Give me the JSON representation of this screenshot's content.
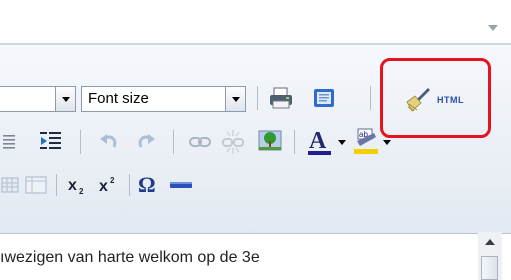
{
  "toolbar": {
    "font_size_label": "Font size",
    "html_button_label": "HTML",
    "icons": [
      "format-dropdown-arrow-icon",
      "print-icon",
      "preview-icon",
      "clean-html-brush-icon",
      "indent-icon",
      "undo-icon",
      "redo-icon",
      "link-icon",
      "unlink-icon",
      "image-icon",
      "text-color-icon",
      "background-color-icon",
      "table-icon",
      "table-cell-icon",
      "subscript-icon",
      "superscript-icon",
      "special-character-icon",
      "horizontal-rule-icon"
    ]
  },
  "editor": {
    "visible_text": "ıwezigen van harte welkom op de 3e"
  },
  "colors": {
    "highlight": "#e8121e",
    "text_color_bar": "#1f1f8f",
    "background_color_bar": "#f2d000"
  }
}
